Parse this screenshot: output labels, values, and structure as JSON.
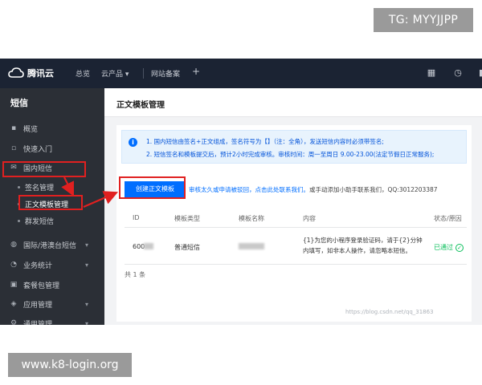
{
  "watermarks": {
    "top": "TG: MYYJJPP",
    "bottom": "www.k8-login.org"
  },
  "topbar": {
    "brand": "腾讯云",
    "nav": [
      "总览",
      "云产品 ▾",
      "网站备案",
      "+"
    ]
  },
  "sidebar": {
    "title": "短信",
    "items": [
      {
        "label": "概览",
        "icon": "grid-icon"
      },
      {
        "label": "快速入门",
        "icon": "book-icon"
      },
      {
        "label": "国内短信",
        "icon": "mail-icon"
      }
    ],
    "subitems": [
      "签名管理",
      "正文模板管理",
      "群发短信"
    ],
    "items2": [
      {
        "label": "国际/港澳台短信",
        "icon": "globe-icon"
      },
      {
        "label": "业务统计",
        "icon": "chart-icon"
      },
      {
        "label": "套餐包管理",
        "icon": "package-icon"
      },
      {
        "label": "应用管理",
        "icon": "layers-icon"
      },
      {
        "label": "通用管理",
        "icon": "settings-icon"
      }
    ]
  },
  "page": {
    "title": "正文模板管理"
  },
  "notice": {
    "line1": "1. 国内短信由签名+正文组成，签名符号为【】（注：全角），发送短信内容时必须带签名;",
    "line2": "2. 短信签名和模板提交后，预计2小时完成审核。审核时间：周一至周日 9.00-23.00(法定节假日正常服务);"
  },
  "create_button": "创建正文模板",
  "hint": {
    "link": "审核太久或申请被驳回，点击此处联系我们。",
    "rest": "或手动添加小助手联系我们，QQ:3012203387"
  },
  "table": {
    "headers": [
      "ID",
      "模板类型",
      "模板名称",
      "内容",
      "状态/原因"
    ],
    "rows": [
      {
        "id": "600",
        "type": "普通短信",
        "content_line1": "{1}为您的小程序登录验证码，请于{2}分钟",
        "content_line2": "内填写，如非本人操作，请忽略本短信。",
        "status": "已通过"
      }
    ],
    "total": "共 1 条"
  },
  "footer_mark": "https://blog.csdn.net/qq_31863"
}
